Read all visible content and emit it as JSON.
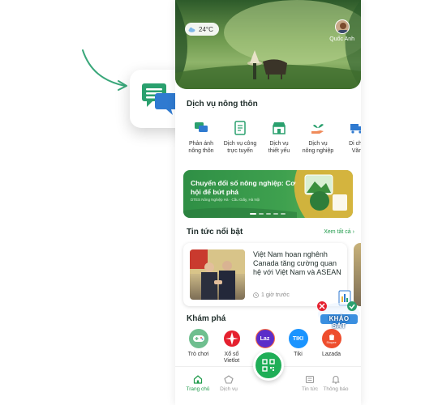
{
  "colors": {
    "brand_green": "#1fae57",
    "link_green": "#1e9a4a",
    "callout_green": "#2aa06e",
    "callout_blue": "#2f7ad0"
  },
  "callout": {
    "icon": "chat-bubbles-icon"
  },
  "hero": {
    "temperature": "24°C",
    "user_name": "Quốc Anh"
  },
  "services": {
    "title": "Dịch vụ nông thôn",
    "items": [
      {
        "label": "Phản ánh\nnông thôn",
        "icon": "feedback-chat-icon"
      },
      {
        "label": "Dịch vụ công\ntrực tuyến",
        "icon": "document-icon"
      },
      {
        "label": "Dịch vụ\nthiết yếu",
        "icon": "storefront-icon"
      },
      {
        "label": "Dịch vụ\nnông nghiệp",
        "icon": "plant-hand-icon"
      },
      {
        "label": "Di chu\nVăn",
        "icon": "truck-icon"
      }
    ]
  },
  "banner": {
    "title": "Chuyển đổi số nông nghiệp: Cơ hội để bứt phá",
    "subtitle": "DTES Nông Nghiệp Hà · Cầu Giấy, Hà Nội"
  },
  "news": {
    "title": "Tin tức nổi bật",
    "view_all": "Xem tất cả",
    "headline": "Việt Nam hoan nghênh Canada tăng cường quan hệ với Việt Nam và ASEAN",
    "time": "1 giờ trước"
  },
  "explore": {
    "title": "Khám phá",
    "items": [
      {
        "label": "Trò chơi",
        "icon": "gamepad-icon",
        "color": "#6fbf8f"
      },
      {
        "label": "Xổ số\nVietlot",
        "icon": "vietlott-icon",
        "color": "#e5202e"
      },
      {
        "label": "",
        "icon": "lazada-icon",
        "color": "#5b2ec9"
      },
      {
        "label": "Tiki",
        "icon": "tiki-icon",
        "color": "#1a94ff"
      },
      {
        "label": "Lazada",
        "icon": "shopee-icon",
        "color": "#ee4d2d"
      }
    ],
    "lazada_badge": "Laz",
    "tiki_badge": "TIKI",
    "shopee_badge": "Shopee"
  },
  "survey": {
    "label": "KHẢO SÁT"
  },
  "tabbar": {
    "items": [
      {
        "label": "Trang chủ",
        "icon": "home-icon",
        "active": true
      },
      {
        "label": "Dịch vụ",
        "icon": "pentagon-icon",
        "active": false
      },
      {
        "label": "Tin tức",
        "icon": "newspaper-icon",
        "active": false
      },
      {
        "label": "Thông báo",
        "icon": "bell-icon",
        "active": false
      }
    ],
    "center": "qr-scan-icon"
  }
}
